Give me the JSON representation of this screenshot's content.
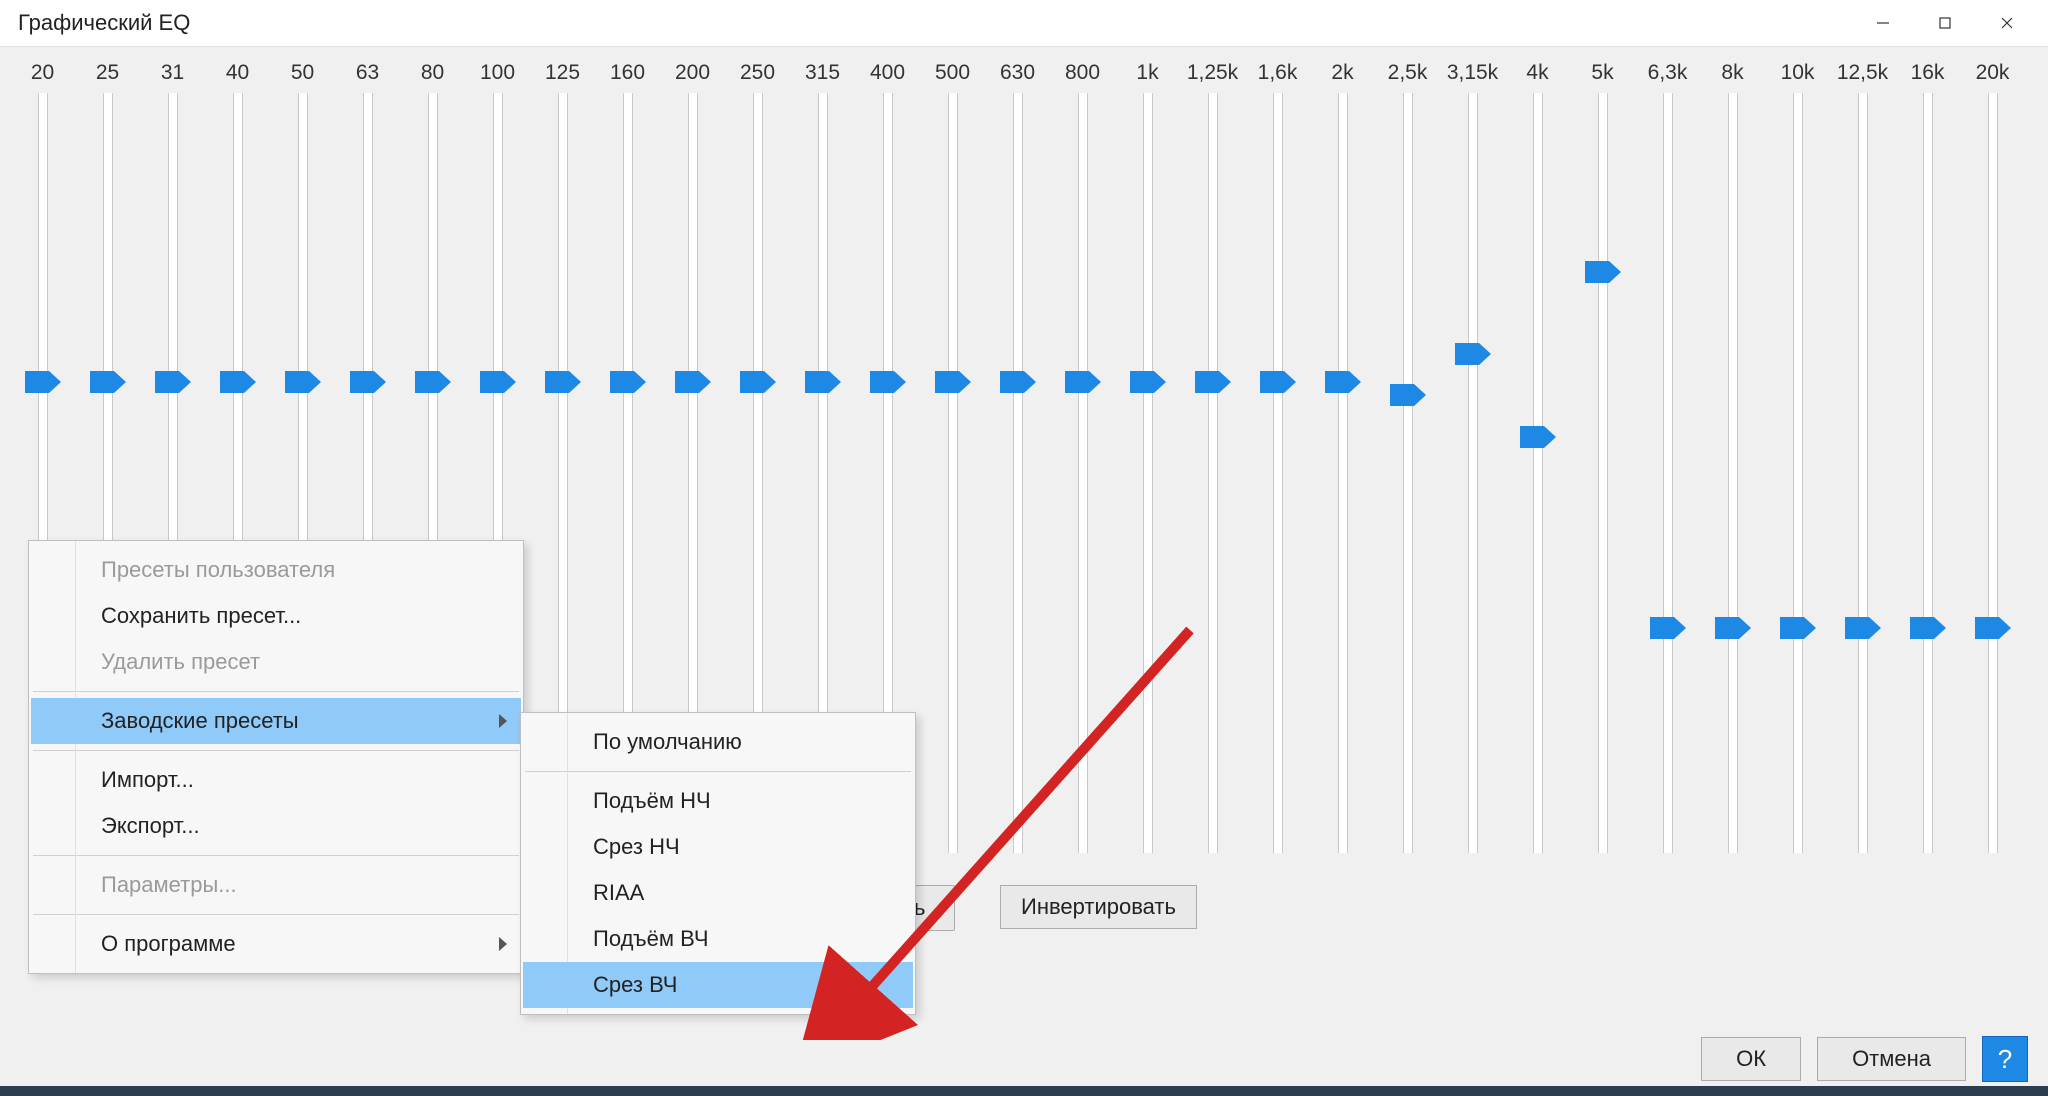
{
  "window": {
    "title": "Графический EQ"
  },
  "buttons": {
    "invert": "Инвертировать",
    "ok": "ОК",
    "cancel": "Отмена",
    "help": "?"
  },
  "menu": {
    "user_presets": "Пресеты пользователя",
    "save_preset": "Сохранить пресет...",
    "delete_preset": "Удалить пресет",
    "factory_presets": "Заводские пресеты",
    "import": "Импорт...",
    "export": "Экспорт...",
    "parameters": "Параметры...",
    "about": "О программе"
  },
  "submenu": {
    "default": "По умолчанию",
    "bass_boost": "Подъём НЧ",
    "bass_cut": "Срез НЧ",
    "riaa": "RIAA",
    "treble_boost": "Подъём ВЧ",
    "treble_cut": "Срез ВЧ"
  },
  "fragment": {
    "cut_button_tail": "ь"
  },
  "eq": {
    "bands": [
      {
        "freq": "20",
        "value": 0
      },
      {
        "freq": "25",
        "value": 0
      },
      {
        "freq": "31",
        "value": 0
      },
      {
        "freq": "40",
        "value": 0
      },
      {
        "freq": "50",
        "value": 0
      },
      {
        "freq": "63",
        "value": 0
      },
      {
        "freq": "80",
        "value": 0
      },
      {
        "freq": "100",
        "value": 0
      },
      {
        "freq": "125",
        "value": 0
      },
      {
        "freq": "160",
        "value": 0
      },
      {
        "freq": "200",
        "value": 0
      },
      {
        "freq": "250",
        "value": 0
      },
      {
        "freq": "315",
        "value": 0
      },
      {
        "freq": "400",
        "value": 0
      },
      {
        "freq": "500",
        "value": 0
      },
      {
        "freq": "630",
        "value": 0
      },
      {
        "freq": "800",
        "value": 0
      },
      {
        "freq": "1k",
        "value": 0
      },
      {
        "freq": "1,25k",
        "value": 0
      },
      {
        "freq": "1,6k",
        "value": 0
      },
      {
        "freq": "2k",
        "value": 0
      },
      {
        "freq": "2,5k",
        "value": -1
      },
      {
        "freq": "3,15k",
        "value": 2
      },
      {
        "freq": "4k",
        "value": -4
      },
      {
        "freq": "5k",
        "value": 8
      },
      {
        "freq": "6,3k",
        "value": -18
      },
      {
        "freq": "8k",
        "value": -18
      },
      {
        "freq": "10k",
        "value": -18
      },
      {
        "freq": "12,5k",
        "value": -18
      },
      {
        "freq": "16k",
        "value": -18
      },
      {
        "freq": "20k",
        "value": -18
      }
    ]
  }
}
